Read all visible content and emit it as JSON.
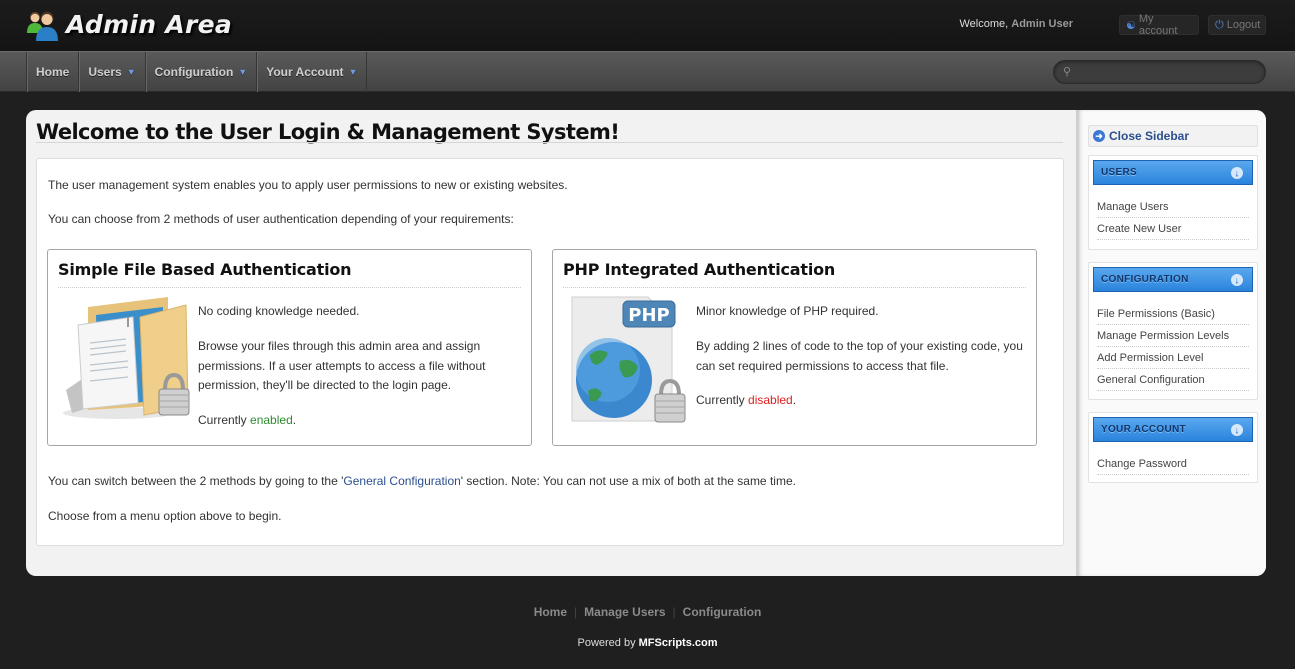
{
  "header": {
    "title": "Admin Area",
    "welcome_prefix": "Welcome,",
    "user_name": "Admin User",
    "my_account_label": "My account",
    "logout_label": "Logout"
  },
  "nav": {
    "items": [
      {
        "label": "Home",
        "has_dropdown": false
      },
      {
        "label": "Users",
        "has_dropdown": true
      },
      {
        "label": "Configuration",
        "has_dropdown": true
      },
      {
        "label": "Your Account",
        "has_dropdown": true
      }
    ],
    "search_placeholder": ""
  },
  "main": {
    "title": "Welcome to the User Login & Management System!",
    "intro_1": "The user management system enables you to apply user permissions to new or existing websites.",
    "intro_2": "You can choose from 2 methods of user authentication depending of your requirements:",
    "cards": [
      {
        "title": "Simple File Based Authentication",
        "icon": "folder-lock-icon",
        "line_1": "No coding knowledge needed.",
        "line_2": "Browse your files through this admin area and assign permissions. If a user attempts to access a file without permission, they'll be directed to the login page.",
        "status_prefix": "Currently",
        "status": "enabled",
        "status_color": "#2e8b2e"
      },
      {
        "title": "PHP Integrated Authentication",
        "icon": "php-globe-lock-icon",
        "line_1": "Minor knowledge of PHP required.",
        "line_2": "By adding 2 lines of code to the top of your existing code, you can set required permissions to access that file.",
        "status_prefix": "Currently",
        "status": "disabled",
        "status_color": "#e02020"
      }
    ],
    "switch_text_before": "You can switch between the 2 methods by going to the '",
    "switch_link": "General Configuration",
    "switch_text_after": "' section. Note: You can not use a mix of both at the same time.",
    "closing": "Choose from a menu option above to begin."
  },
  "sidebar": {
    "close_label": "Close Sidebar",
    "sections": [
      {
        "title": "USERS",
        "items": [
          "Manage Users",
          "Create New User"
        ]
      },
      {
        "title": "CONFIGURATION",
        "items": [
          "File Permissions (Basic)",
          "Manage Permission Levels",
          "Add Permission Level",
          "General Configuration"
        ]
      },
      {
        "title": "YOUR ACCOUNT",
        "items": [
          "Change Password"
        ]
      }
    ]
  },
  "footer": {
    "links": [
      "Home",
      "Manage Users",
      "Configuration"
    ],
    "powered_prefix": "Powered by",
    "powered_brand": "MFScripts.com"
  },
  "colors": {
    "accent": "#2a84dc",
    "link": "#2b4f8e",
    "enabled": "#2e8b2e",
    "disabled": "#e02020"
  }
}
